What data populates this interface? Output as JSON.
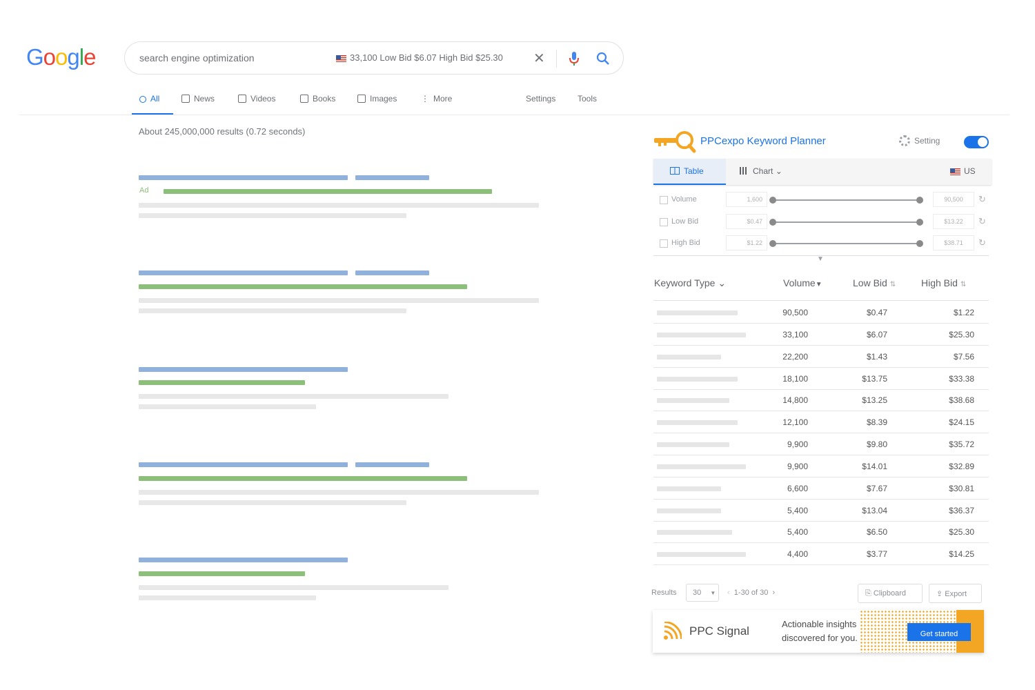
{
  "google": {
    "logo": [
      "G",
      "o",
      "o",
      "g",
      "l",
      "e"
    ],
    "logo_colors": [
      "#4285F4",
      "#EA4335",
      "#FBBC05",
      "#4285F4",
      "#34A853",
      "#EA4335"
    ],
    "query": "search engine optimization",
    "inline_stats": "33,100   Low Bid $6.07  High Bid $25.30",
    "tabs": [
      "All",
      "News",
      "Videos",
      "Books",
      "Images",
      "More"
    ],
    "settings": "Settings",
    "tools": "Tools",
    "result_stats": "About 245,000,000 results (0.72 seconds)",
    "ad_label": "Ad"
  },
  "panel": {
    "title": "PPCexpo Keyword Planner",
    "setting": "Setting",
    "tab_table": "Table",
    "tab_chart": "Chart",
    "country": "US",
    "filters": [
      {
        "label": "Volume",
        "min": "1,600",
        "max": "90,500"
      },
      {
        "label": "Low Bid",
        "min": "$0.47",
        "max": "$13.22"
      },
      {
        "label": "High Bid",
        "min": "$1.22",
        "max": "$38.71"
      }
    ],
    "columns": [
      "Keyword Type",
      "Volume",
      "Low Bid",
      "High Bid"
    ],
    "rows": [
      {
        "volume": "90,500",
        "low": "$0.47",
        "high": "$1.22"
      },
      {
        "volume": "33,100",
        "low": "$6.07",
        "high": "$25.30"
      },
      {
        "volume": "22,200",
        "low": "$1.43",
        "high": "$7.56"
      },
      {
        "volume": "18,100",
        "low": "$13.75",
        "high": "$33.38"
      },
      {
        "volume": "14,800",
        "low": "$13.25",
        "high": "$38.68"
      },
      {
        "volume": "12,100",
        "low": "$8.39",
        "high": "$24.15"
      },
      {
        "volume": "9,900",
        "low": "$9.80",
        "high": "$35.72"
      },
      {
        "volume": "9,900",
        "low": "$14.01",
        "high": "$32.89"
      },
      {
        "volume": "6,600",
        "low": "$7.67",
        "high": "$30.81"
      },
      {
        "volume": "5,400",
        "low": "$13.04",
        "high": "$36.37"
      },
      {
        "volume": "5,400",
        "low": "$6.50",
        "high": "$25.30"
      },
      {
        "volume": "4,400",
        "low": "$3.77",
        "high": "$14.25"
      }
    ],
    "results_label": "Results",
    "results_per_page": "30",
    "pagination": "1-30 of 30",
    "clipboard": "Clipboard",
    "export": "Export"
  },
  "ad": {
    "brand": "PPC Signal",
    "tagline": "Actionable insights discovered for you.",
    "cta": "Get started"
  },
  "colors": {
    "accent": "#1a73e8",
    "ad_orange": "#f3a623"
  }
}
